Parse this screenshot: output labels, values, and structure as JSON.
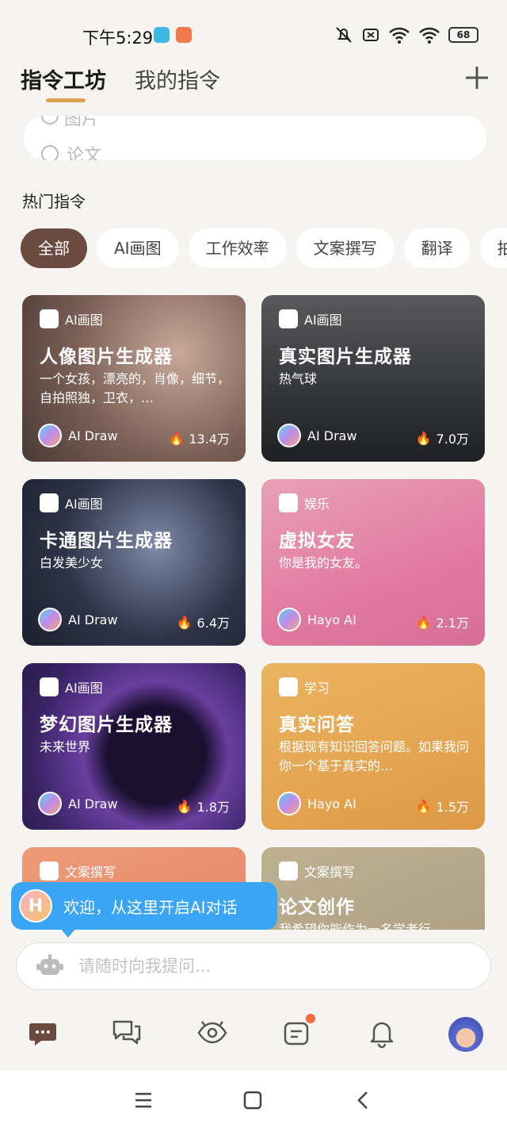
{
  "status_bar": {
    "time": "下午5:29",
    "battery": "68"
  },
  "header": {
    "tabs": [
      {
        "label": "指令工坊"
      },
      {
        "label": "我的指令"
      }
    ],
    "add_icon": "plus-icon"
  },
  "search": {
    "row1": "图片",
    "row2": "论文"
  },
  "section_title": "热门指令",
  "filters": [
    "全部",
    "AI画图",
    "工作效率",
    "文案撰写",
    "翻译",
    "拍"
  ],
  "active_filter": "全部",
  "cards": [
    {
      "category": "AI画图",
      "title": "人像图片生成器",
      "desc": "一个女孩，漂亮的，肖像，细节，自拍照独，卫衣，…",
      "author": "AI Draw",
      "likes": "13.4万",
      "bg": "#6f5a52"
    },
    {
      "category": "AI画图",
      "title": "真实图片生成器",
      "desc": "热气球",
      "author": "AI Draw",
      "likes": "7.0万",
      "bg": "#3c3e44"
    },
    {
      "category": "AI画图",
      "title": "卡通图片生成器",
      "desc": "白发美少女",
      "author": "AI Draw",
      "likes": "6.4万",
      "bg": "#2c3046"
    },
    {
      "category": "娱乐",
      "title": "虚拟女友",
      "desc": "你是我的女友。",
      "author": "Hayo AI",
      "likes": "2.1万",
      "bg": "#e07ea4"
    },
    {
      "category": "AI画图",
      "title": "梦幻图片生成器",
      "desc": "未来世界",
      "author": "AI Draw",
      "likes": "1.8万",
      "bg": "#5b3a86"
    },
    {
      "category": "学习",
      "title": "真实问答",
      "desc": "根据现有知识回答问题。如果我问你一个基于真实的…",
      "author": "Hayo AI",
      "likes": "1.5万",
      "bg": "#e3a950"
    },
    {
      "category": "文案撰写",
      "title": "",
      "desc": "",
      "author": "",
      "likes": "",
      "bg": "#e58f6e"
    },
    {
      "category": "文案撰写",
      "title": "论文创作",
      "desc": "我希望你能作为一名学者行",
      "author": "",
      "likes": "",
      "bg": "#b7a88c"
    }
  ],
  "toast": {
    "logo": "H",
    "text": "欢迎，从这里开启AI对话"
  },
  "chat_input": {
    "placeholder": "请随时向我提问..."
  },
  "bottom_nav": [
    "chat-icon",
    "messages-icon",
    "eye-icon",
    "notes-icon",
    "bell-icon",
    "avatar"
  ]
}
